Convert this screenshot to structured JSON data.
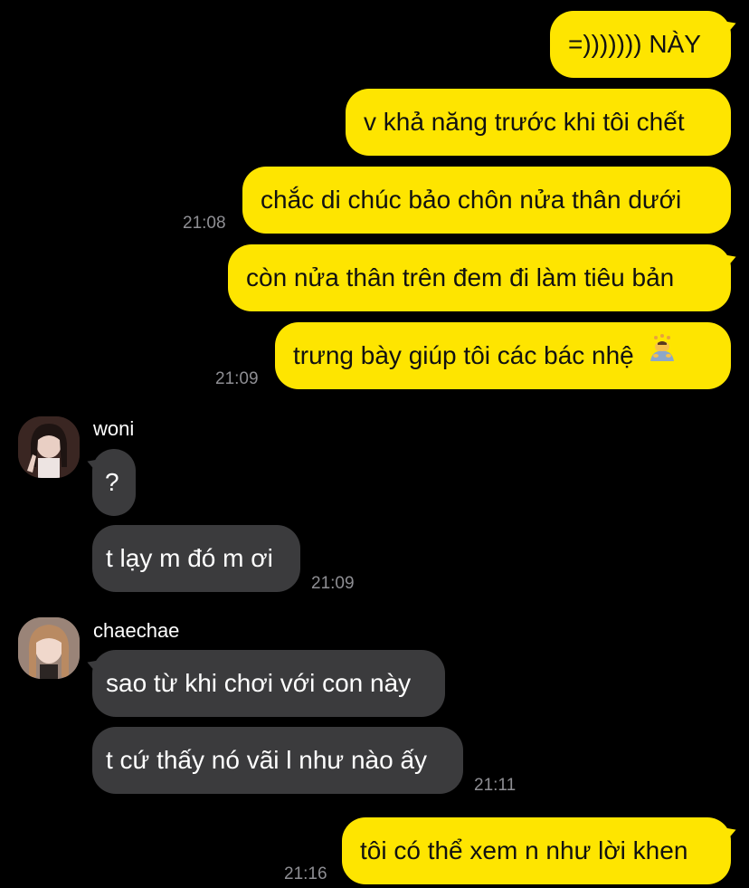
{
  "messages": {
    "m1": "=))))))) NÀY",
    "m2": "v khả năng trước khi tôi chết",
    "m3": "chắc di chúc bảo chôn nửa thân dưới",
    "m4": "còn nửa thân trên đem đi làm tiêu bản",
    "m5": "trưng bày giúp tôi các bác nhệ",
    "m6": "?",
    "m7": "t lạy m đó m ơi",
    "m8": "sao từ khi chơi với con này",
    "m9": "t cứ thấy nó vãi l như nào ấy",
    "m10": "tôi có thể xem n như lời khen"
  },
  "times": {
    "t1": "21:08",
    "t2": "21:09",
    "t3": "21:09",
    "t4": "21:11",
    "t5": "21:16"
  },
  "senders": {
    "woni": "woni",
    "chaechae": "chaechae"
  },
  "icons": {
    "m5_emoji": "person-bowing-emoji"
  },
  "colors": {
    "outgoing_bubble": "#FEE500",
    "incoming_bubble": "#3B3B3D",
    "background": "#000000",
    "timestamp": "#8E8E93"
  }
}
